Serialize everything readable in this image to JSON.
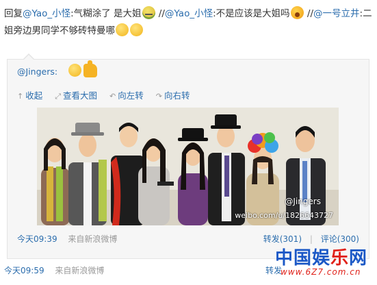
{
  "reply": {
    "prefix": "回复",
    "mention1": "@Yao_小怪",
    "text1": ":气糊涂了 是大姐",
    "sep1": " //",
    "mention2": "@Yao_小怪",
    "text2": ":不是应该是大姐吗",
    "sep2": " //",
    "mention3": "@一号立井",
    "text3": ":二姐旁边男同学不够砖特曼哪"
  },
  "quote": {
    "author": "@Jingers",
    "author_suffix": ":",
    "tools": [
      {
        "icon": "collapse-icon",
        "glyph": "↑",
        "label": "收起"
      },
      {
        "icon": "view-large-icon",
        "glyph": "⤢",
        "label": "查看大图"
      },
      {
        "icon": "rotate-left-icon",
        "glyph": "↶",
        "label": "向左转"
      },
      {
        "icon": "rotate-right-icon",
        "glyph": "↷",
        "label": "向右转"
      }
    ],
    "photo": {
      "watermark_user": "@Jingers",
      "watermark_url": "weibo.com/u/1826643727"
    },
    "time": "今天09:39",
    "source": "来自新浪微博",
    "repost": "转发(301)",
    "stats_sep": "|",
    "comment": "评论(300)"
  },
  "footer": {
    "time": "今天09:59",
    "source": "来自新浪微博",
    "repost": "转发"
  },
  "logo": {
    "text_a": "中国娱",
    "text_b": "乐",
    "text_c": "网",
    "sub": "www.6Z7.com.cn"
  },
  "colors": {
    "link": "#2b6dad",
    "muted": "#999999",
    "logo_blue": "#1b58c6",
    "logo_red": "#e0221a"
  }
}
